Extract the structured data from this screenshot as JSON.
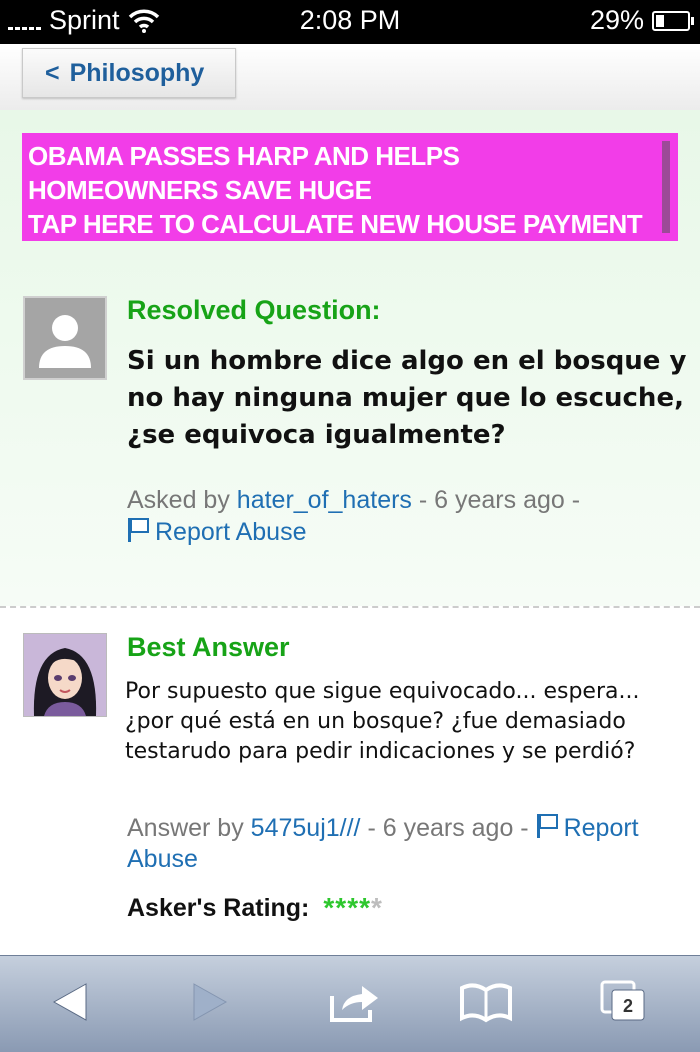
{
  "status_bar": {
    "carrier": "Sprint",
    "time": "2:08 PM",
    "battery_percent": "29%",
    "battery_level": 0.29
  },
  "nav": {
    "back_label": "Philosophy"
  },
  "ad": {
    "line1": "OBAMA PASSES HARP AND HELPS",
    "line2": "HOMEOWNERS SAVE HUGE",
    "line3": "TAP HERE TO CALCULATE NEW HOUSE PAYMENT",
    "color": "#f23de8"
  },
  "question": {
    "status_label": "Resolved Question:",
    "text": "Si un hombre dice algo en el bosque y no hay ninguna mujer que lo escuche, ¿se equivoca igualmente?",
    "asked_prefix": "Asked by",
    "asker": "hater_of_haters",
    "age": "- 6 years ago -",
    "report_label": "Report Abuse"
  },
  "best_answer": {
    "label": "Best Answer",
    "text": "Por supuesto que sigue equivocado... espera... ¿por qué está en un bosque? ¿fue demasiado testarudo para pedir indicaciones y se perdió?",
    "answer_prefix": "Answer by",
    "answerer": "5475uj1///",
    "age": "- 6 years ago -",
    "report_label": "Report Abuse",
    "rating_label": "Asker's Rating:",
    "rating": 4,
    "rating_max": 5
  },
  "colors": {
    "accent_green": "#17a317",
    "link_blue": "#1f6fb3",
    "star_green": "#2ec72e"
  },
  "toolbar": {
    "icons": [
      "back-arrow-icon",
      "forward-arrow-icon",
      "share-icon",
      "bookmarks-icon",
      "tabs-icon"
    ],
    "tab_count": "2"
  }
}
